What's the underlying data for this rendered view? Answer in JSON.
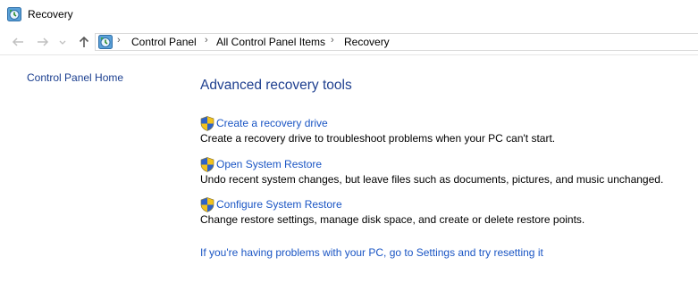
{
  "window": {
    "title": "Recovery",
    "icon": "recovery-icon"
  },
  "nav": {
    "back_icon": "arrow-left-icon",
    "forward_icon": "arrow-right-icon",
    "recent_icon": "chevron-down-icon",
    "up_icon": "arrow-up-icon"
  },
  "breadcrumb": {
    "separator": "›",
    "items": [
      "Control Panel",
      "All Control Panel Items",
      "Recovery"
    ]
  },
  "sidebar": {
    "home_label": "Control Panel Home"
  },
  "main": {
    "heading": "Advanced recovery tools",
    "tools": [
      {
        "icon": "uac-shield-icon",
        "label": "Create a recovery drive",
        "description": "Create a recovery drive to troubleshoot problems when your PC can't start."
      },
      {
        "icon": "uac-shield-icon",
        "label": "Open System Restore",
        "description": "Undo recent system changes, but leave files such as documents, pictures, and music unchanged."
      },
      {
        "icon": "uac-shield-icon",
        "label": "Configure System Restore",
        "description": "Change restore settings, manage disk space, and create or delete restore points."
      }
    ],
    "reset_link": "If you're having problems with your PC, go to Settings and try resetting it"
  },
  "colors": {
    "heading": "#1e3f8f",
    "link": "#1a55c4",
    "sidebar_link": "#1a3e8f"
  }
}
